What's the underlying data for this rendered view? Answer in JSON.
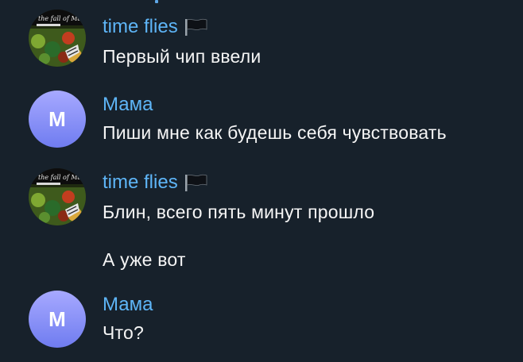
{
  "messages": [
    {
      "sender": "time flies",
      "sender_icon": "flag-icon",
      "avatar": "album-art-avatar",
      "lines": [
        "Первый чип ввели"
      ]
    },
    {
      "sender": "Мама",
      "avatar_initial": "М",
      "lines": [
        "Пиши мне как будешь себя чувствовать"
      ]
    },
    {
      "sender": "time flies",
      "sender_icon": "flag-icon",
      "avatar": "album-art-avatar",
      "lines": [
        "Блин, всего пять минут прошло",
        "А уже вот"
      ]
    },
    {
      "sender": "Мама",
      "avatar_initial": "М",
      "lines": [
        "Что?"
      ]
    }
  ],
  "colors": {
    "background": "#17212b",
    "sender_name": "#5eb5f7",
    "message_text": "#f5f5f5",
    "avatar_gradient_top": "#a7a9ff",
    "avatar_gradient_bottom": "#6f7cf0"
  }
}
